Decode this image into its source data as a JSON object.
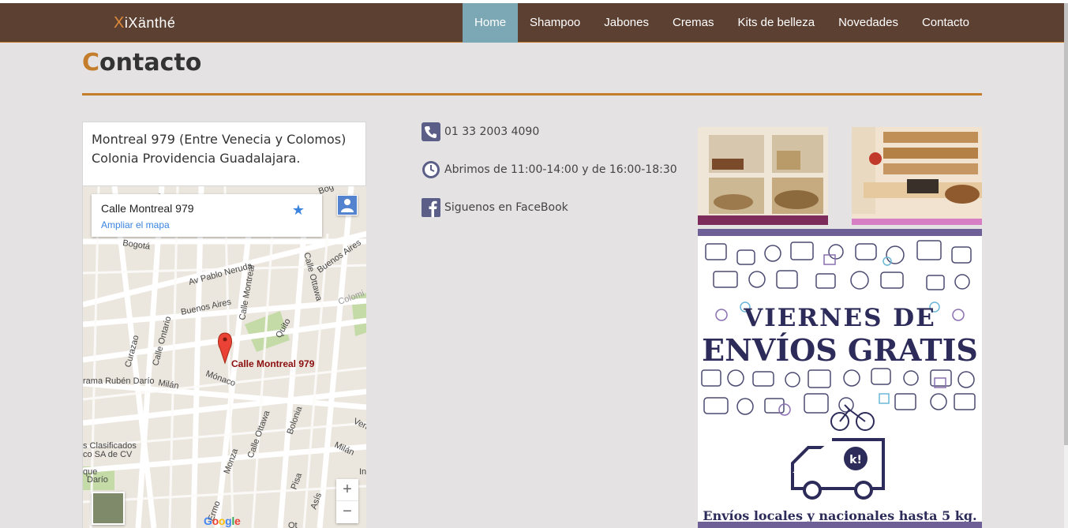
{
  "brand": {
    "logo_initial": "X",
    "logo_rest": "iXänthé"
  },
  "nav": {
    "items": [
      {
        "label": "Home",
        "active": true
      },
      {
        "label": "Shampoo"
      },
      {
        "label": "Jabones"
      },
      {
        "label": "Cremas"
      },
      {
        "label": "Kits de belleza"
      },
      {
        "label": "Novedades"
      },
      {
        "label": "Contacto"
      }
    ]
  },
  "page": {
    "title_initial": "C",
    "title_rest": "ontacto"
  },
  "address": {
    "line1": "Montreal 979 (Entre Venecia y Colomos)",
    "line2": "Colonia Providencia Guadalajara."
  },
  "map": {
    "place_title": "Calle Montreal 979",
    "enlarge_link": "Ampliar el mapa",
    "marker_label": "Calle Montreal 979",
    "zoom_in": "+",
    "zoom_out": "−",
    "attribution": "Google",
    "street_labels": [
      "Av Pablo Neruda",
      "Buenos Aires",
      "Calle Montreal",
      "Calle Ottawa",
      "Buenos Aires",
      "Calle Ontario",
      "Curazao",
      "Quito",
      "Mónaco",
      "Milán",
      "rama Rubén Darío",
      "Calle Ottawa",
      "Bolonia",
      "Monza",
      "Pisa",
      "Asís",
      "Milán",
      "Ven",
      "s Clasificados",
      "co SA de CV",
      "que",
      "Darío",
      "Bogotá",
      "Colomi",
      "Bog",
      "Ermo",
      "In",
      "Ot",
      "lo"
    ]
  },
  "contact": {
    "phone": "01 33 2003 4090",
    "hours": "Abrimos de 11:00-14:00 y de 16:00-18:30",
    "facebook": "Siguenos en FaceBook"
  },
  "promo": {
    "line1": "VIERNES DE",
    "line2": "ENVÍOS GRATIS",
    "line3": "Envíos locales y nacionales hasta 5 kg.",
    "badge": "k!"
  },
  "colors": {
    "nav_bg": "#5c4032",
    "nav_active": "#7ba8b4",
    "accent": "#c47d2a",
    "page_bg": "#e4e2e3",
    "promo_bar": "#6e5f96",
    "promo_text": "#2c2b59",
    "icon": "#5b5e86"
  },
  "icons": [
    "phone-icon",
    "clock-icon",
    "facebook-icon",
    "star-icon",
    "pegman-icon",
    "map-marker-icon"
  ]
}
